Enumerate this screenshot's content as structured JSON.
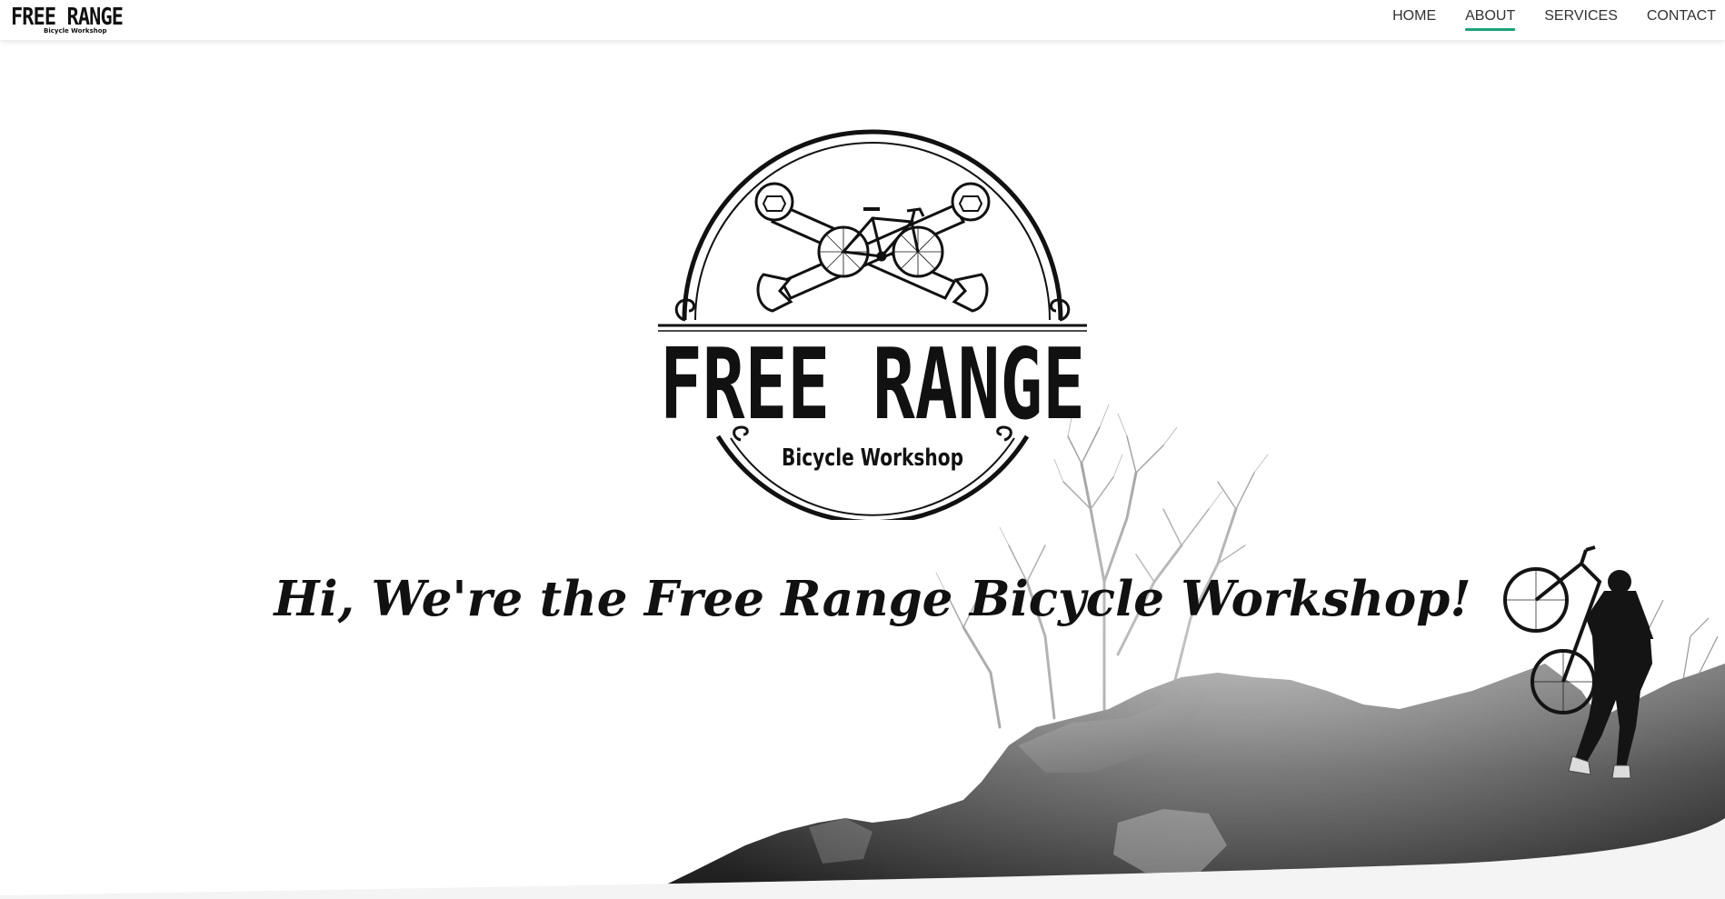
{
  "nav": {
    "brand_title": "FREE RANGE",
    "brand_subtitle": "Bicycle Workshop",
    "links": [
      {
        "label": "HOME",
        "active": false
      },
      {
        "label": "ABOUT",
        "active": true
      },
      {
        "label": "SERVICES",
        "active": false
      },
      {
        "label": "CONTACT",
        "active": false
      }
    ],
    "active_indicator_color": "#1aa37a"
  },
  "hero": {
    "logo": {
      "title": "FREE RANGE",
      "subtitle": "Bicycle Workshop",
      "icons": [
        "wrench-icon",
        "bicycle-icon"
      ]
    },
    "headline": "Hi, We're the Free Range Bicycle Workshop!",
    "background_image": "black-and-white hillside with cyclist carrying bicycle"
  }
}
